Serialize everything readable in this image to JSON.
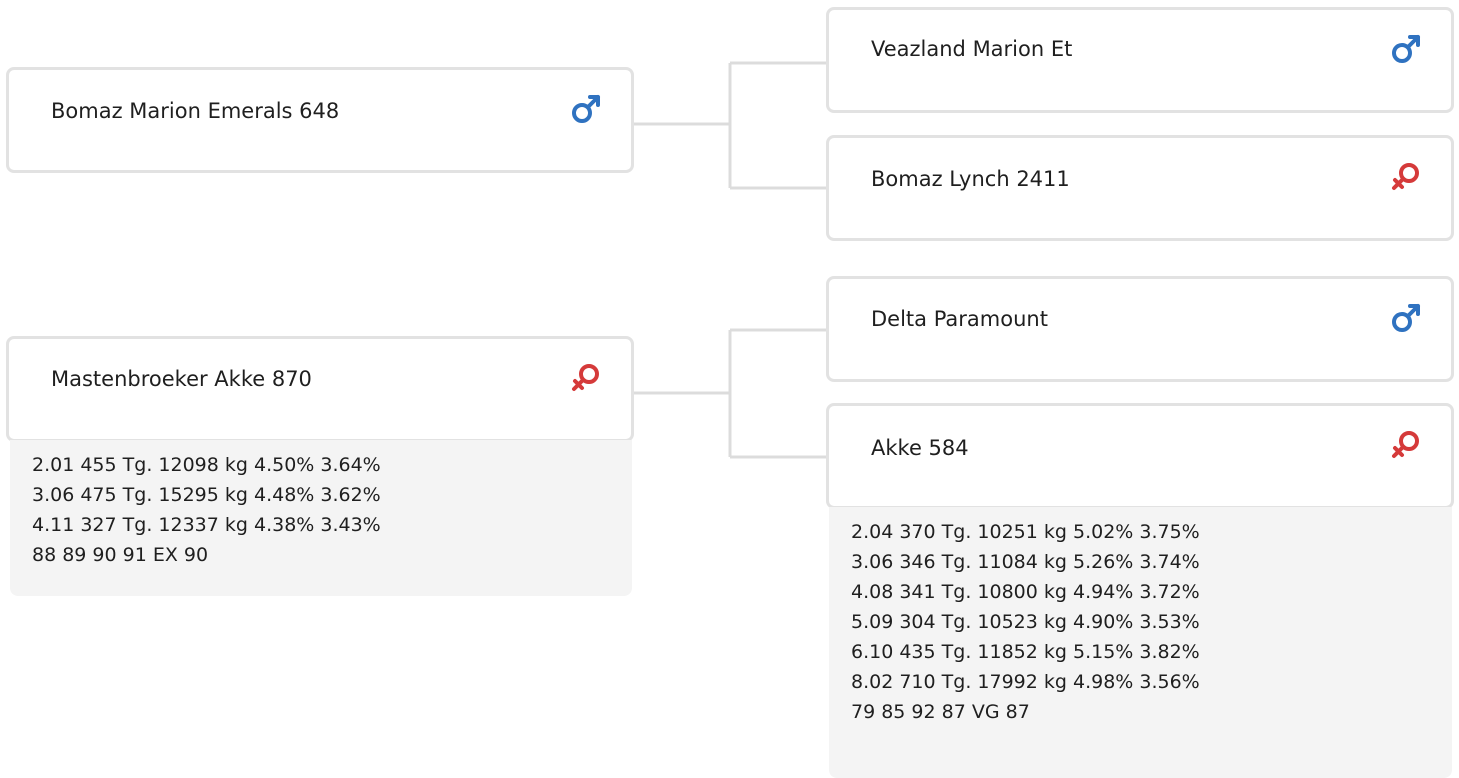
{
  "colors": {
    "male": "#2f72c0",
    "female": "#d53a3a",
    "card_border": "#e2e2e2",
    "info_bg": "#f4f4f4",
    "connector": "#dcdcdc"
  },
  "parents": [
    {
      "name": "Bomaz Marion Emerals 648",
      "sex": "male",
      "icon": "male-icon",
      "parents": [
        {
          "name": "Veazland Marion Et",
          "sex": "male",
          "icon": "male-icon"
        },
        {
          "name": "Bomaz Lynch 2411",
          "sex": "female",
          "icon": "female-icon"
        }
      ]
    },
    {
      "name": "Mastenbroeker Akke 870",
      "sex": "female",
      "icon": "female-icon",
      "info": [
        "2.01 455 Tg. 12098 kg 4.50% 3.64%",
        "3.06 475 Tg. 15295 kg 4.48% 3.62%",
        "4.11 327 Tg. 12337 kg 4.38% 3.43%",
        "88 89 90 91 EX 90"
      ],
      "parents": [
        {
          "name": "Delta Paramount",
          "sex": "male",
          "icon": "male-icon"
        },
        {
          "name": "Akke 584",
          "sex": "female",
          "icon": "female-icon",
          "info": [
            "2.04 370 Tg. 10251 kg 5.02% 3.75%",
            "3.06 346 Tg. 11084 kg 5.26% 3.74%",
            "4.08 341 Tg. 10800 kg 4.94% 3.72%",
            "5.09 304 Tg. 10523 kg 4.90% 3.53%",
            "6.10 435 Tg. 11852 kg 5.15% 3.82%",
            "8.02 710 Tg. 17992 kg 4.98% 3.56%",
            "79 85 92 87 VG 87"
          ]
        }
      ]
    }
  ]
}
